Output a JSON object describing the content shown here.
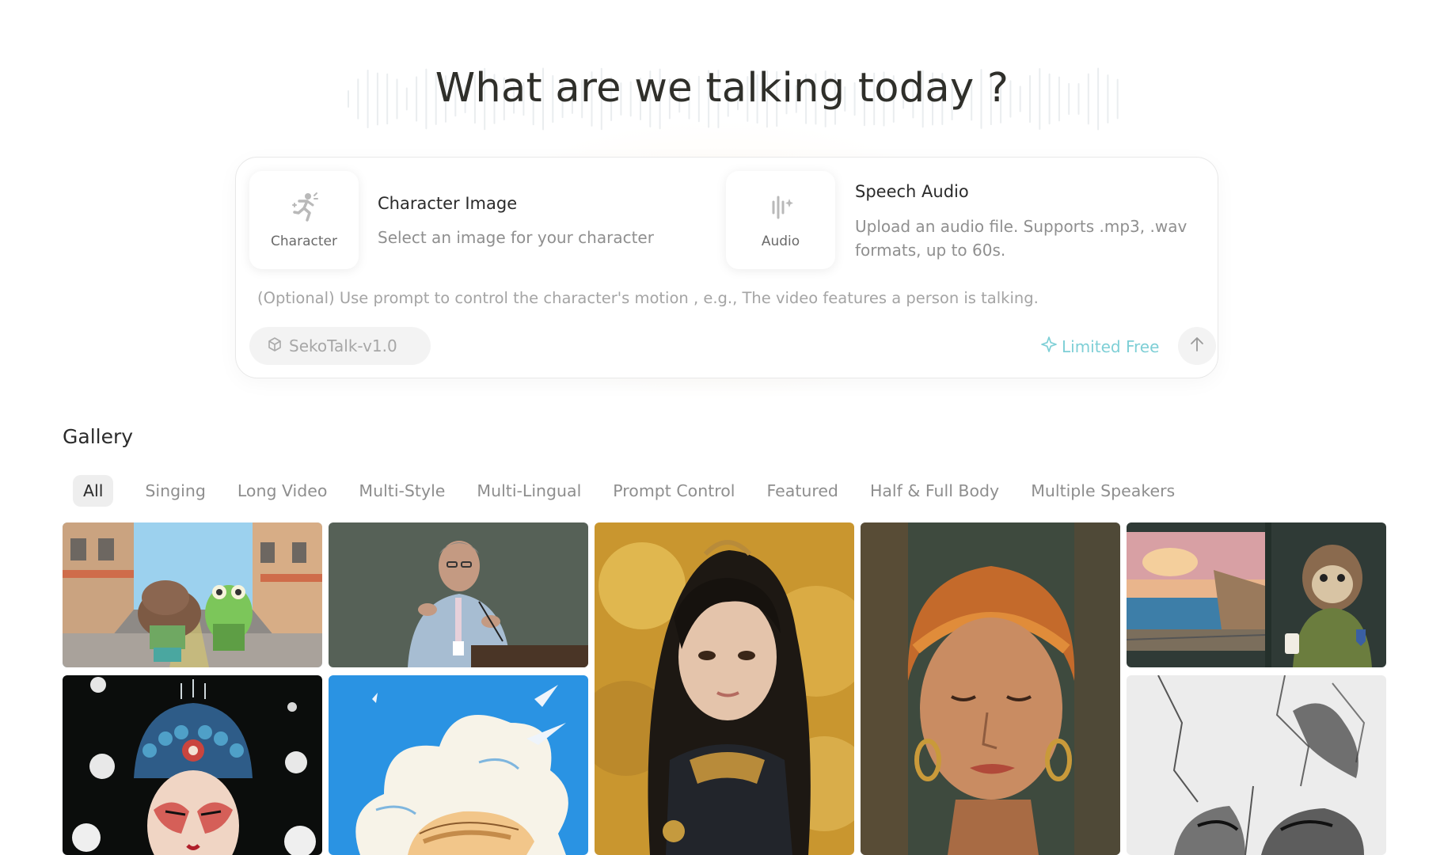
{
  "hero": {
    "title": "What are we talking today ?"
  },
  "composer": {
    "character_tile_label": "Character",
    "character_title": "Character Image",
    "character_desc": "Select an image for your character",
    "audio_tile_label": "Audio",
    "audio_title": "Speech Audio",
    "audio_desc": "Upload an audio file. Supports .mp3, .wav formats, up to 60s.",
    "prompt_placeholder": "(Optional) Use prompt to control the character's motion , e.g., The video features a person is talking.",
    "model_label": "SekoTalk-v1.0",
    "limited_free_label": "Limited Free"
  },
  "gallery": {
    "title": "Gallery",
    "filters": [
      {
        "label": "All",
        "active": true
      },
      {
        "label": "Singing"
      },
      {
        "label": "Long Video"
      },
      {
        "label": "Multi-Style"
      },
      {
        "label": "Multi-Lingual"
      },
      {
        "label": "Prompt Control"
      },
      {
        "label": "Featured"
      },
      {
        "label": "Half & Full Body"
      },
      {
        "label": "Multiple Speakers"
      }
    ]
  },
  "colors": {
    "accent": "#7ecfd6",
    "text": "#2b2b2b",
    "muted": "#8e8e8e",
    "pill_bg": "#f3f3f3"
  },
  "icons": [
    "character-icon",
    "audio-wave-icon",
    "cube-icon",
    "sparkle-icon",
    "arrow-up-icon"
  ]
}
